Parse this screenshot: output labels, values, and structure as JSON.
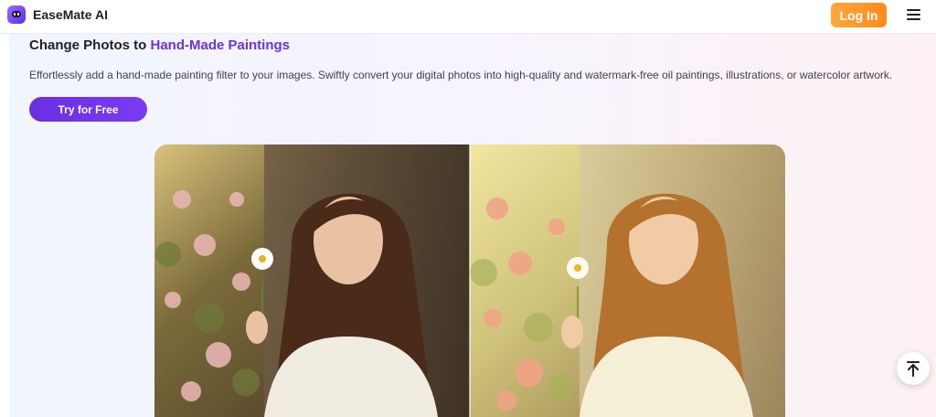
{
  "header": {
    "brand": "EaseMate AI",
    "login_label": "Log In",
    "logo_icon": "easemate-logo-icon",
    "menu_icon": "hamburger-menu-icon"
  },
  "hero": {
    "title_prefix": "Change Photos to",
    "title_highlight": "Hand-Made Paintings",
    "description": "Effortlessly add a hand-made painting filter to your images. Swiftly convert your digital photos into high-quality and watermark-free oil paintings, illustrations, or watercolor artwork.",
    "cta_label": "Try for Free"
  },
  "comparison": {
    "before_image": "original photo of a woman holding a daisy",
    "after_image": "watercolor painting version of the same photo"
  },
  "scroll_top_icon": "arrow-up-to-top-icon",
  "colors": {
    "accent_purple": "#6b31e8",
    "login_orange": "#ff9a2a"
  }
}
